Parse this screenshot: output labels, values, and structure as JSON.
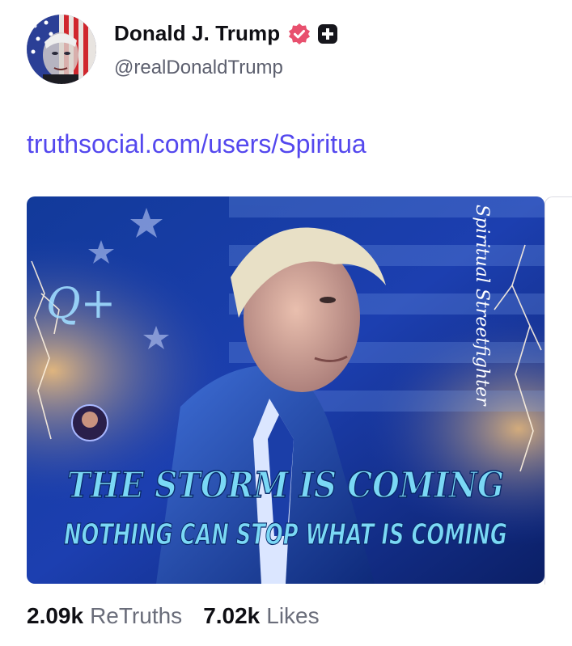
{
  "post": {
    "author_name": "Donald J. Trump",
    "author_handle": "@realDonaldTrump",
    "link_text": "truthsocial.com/users/Spiritua",
    "media": {
      "headline": "THE STORM IS COMING",
      "subline": "NOTHING CAN STOP WHAT IS COMING",
      "side_text": "Spiritual Streetfighter",
      "emblem": "Q+"
    },
    "stats": {
      "retruths_count": "2.09k",
      "retruths_label": "ReTruths",
      "likes_count": "7.02k",
      "likes_label": "Likes"
    }
  },
  "colors": {
    "link": "#5448ee",
    "verified": "#e8506e",
    "muted_text": "#6a6d7a",
    "headline_fill": "#7ad8f5"
  },
  "icons": {
    "verified": "verified-badge-icon",
    "plus": "truth-plus-icon"
  }
}
